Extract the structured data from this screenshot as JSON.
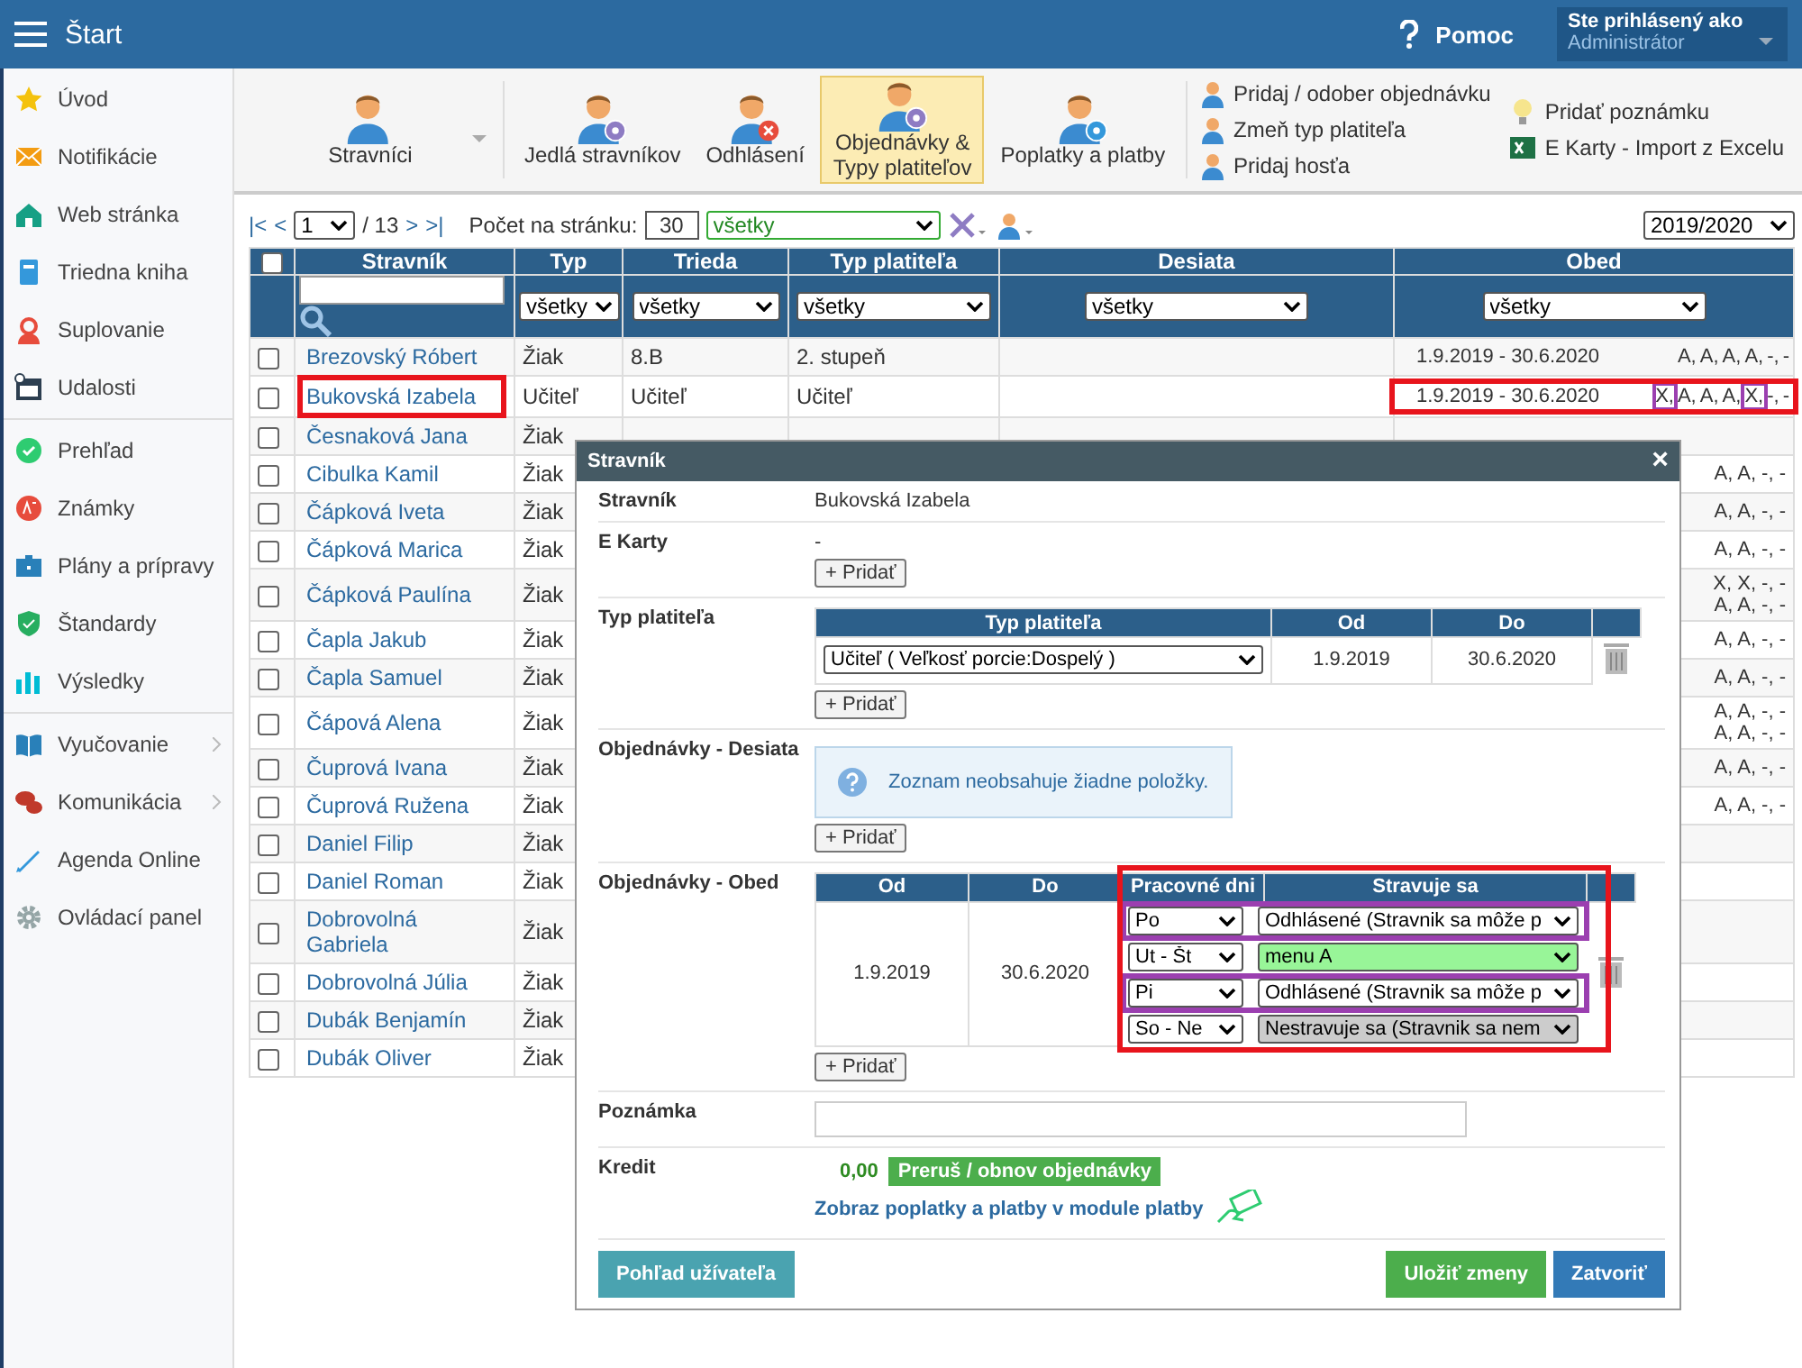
{
  "header": {
    "title": "Štart",
    "help": "Pomoc",
    "user_label": "Ste prihlásený ako",
    "user_name": "Administrátor"
  },
  "sidebar": {
    "groups": [
      [
        {
          "label": "Úvod",
          "chevron": false
        },
        {
          "label": "Notifikácie",
          "chevron": false
        },
        {
          "label": "Web stránka",
          "chevron": false
        },
        {
          "label": "Triedna kniha",
          "chevron": false
        },
        {
          "label": "Suplovanie",
          "chevron": false
        },
        {
          "label": "Udalosti",
          "chevron": false
        }
      ],
      [
        {
          "label": "Prehľad",
          "chevron": false
        },
        {
          "label": "Známky",
          "chevron": false
        },
        {
          "label": "Plány a prípravy",
          "chevron": false
        },
        {
          "label": "Štandardy",
          "chevron": false
        },
        {
          "label": "Výsledky",
          "chevron": false
        }
      ],
      [
        {
          "label": "Vyučovanie",
          "chevron": true
        },
        {
          "label": "Komunikácia",
          "chevron": true
        },
        {
          "label": "Agenda Online",
          "chevron": false
        },
        {
          "label": "Ovládací panel",
          "chevron": false
        }
      ]
    ]
  },
  "toolbar": {
    "buttons": [
      {
        "label": "Stravníci",
        "selected": false,
        "dropdown": true
      },
      {
        "label": "Jedlá stravníkov",
        "selected": false,
        "dropdown": false
      },
      {
        "label": "Odhlásení",
        "selected": false,
        "dropdown": false
      },
      {
        "label": "Objednávky & Typy platiteľov",
        "selected": true,
        "dropdown": false
      },
      {
        "label": "Poplatky a platby",
        "selected": false,
        "dropdown": false
      }
    ],
    "links": [
      [
        "Pridaj / odober objednávku",
        "Zmeň typ platiteľa",
        "Pridaj hosťa"
      ],
      [
        "Pridať poznámku",
        "E Karty - Import z Excelu"
      ]
    ]
  },
  "pager": {
    "first": "|<",
    "prev": "<",
    "page": "1",
    "total": "/ 13",
    "next": ">",
    "last": ">|",
    "per_page_label": "Počet na stránku:",
    "per_page": "30",
    "filter": "všetky",
    "year": "2019/2020"
  },
  "table": {
    "select_all": {
      "checked": false
    },
    "columns": [
      "Stravník",
      "Typ",
      "Trieda",
      "Typ platiteľa",
      "Desiata",
      "Obed"
    ],
    "filters": [
      "všetky",
      "všetky",
      "všetky",
      "všetky",
      "všetky"
    ],
    "rows": [
      {
        "checked": false,
        "name": "Brezovský Róbert",
        "typ": "Žiak",
        "trieda": "8.B",
        "platitel": "2. stupeň",
        "obed_date": "1.9.2019 - 30.6.2020",
        "codes": [
          {
            "code": "A,",
            "marked": false
          },
          {
            "code": "A,",
            "marked": false
          },
          {
            "code": "A,",
            "marked": false
          },
          {
            "code": "A,",
            "marked": false
          },
          {
            "code": "-,",
            "marked": false
          },
          {
            "code": "-",
            "marked": false
          }
        ],
        "highlight": false
      },
      {
        "checked": false,
        "name": "Bukovská Izabela",
        "typ": "Učiteľ",
        "trieda": "Učiteľ",
        "platitel": "Učiteľ",
        "obed_date": "1.9.2019 - 30.6.2020",
        "codes": [
          {
            "code": "X,",
            "marked": true
          },
          {
            "code": "A,",
            "marked": false
          },
          {
            "code": "A,",
            "marked": false
          },
          {
            "code": "A,",
            "marked": false
          },
          {
            "code": "X,",
            "marked": true
          },
          {
            "code": "-,",
            "marked": false
          },
          {
            "code": "-",
            "marked": false
          }
        ],
        "highlight": true
      }
    ],
    "covered_rows": [
      {
        "checked": false,
        "name": "Česnaková Jana",
        "typ": "Žiak",
        "obed_tail": []
      },
      {
        "checked": false,
        "name": "Cibulka Kamil",
        "typ": "Žiak",
        "obed_tail": [
          "A, A, -, -"
        ]
      },
      {
        "checked": false,
        "name": "Čápková Iveta",
        "typ": "Žiak",
        "obed_tail": [
          "A, A, -, -"
        ]
      },
      {
        "checked": false,
        "name": "Čápková Marica",
        "typ": "Žiak",
        "obed_tail": [
          "A, A, -, -"
        ]
      },
      {
        "checked": false,
        "name": "Čápková Paulína",
        "typ": "Žiak",
        "obed_tail": [
          "X, X, -, -",
          "A, A, -, -"
        ]
      },
      {
        "checked": false,
        "name": "Čapla Jakub",
        "typ": "Žiak",
        "obed_tail": [
          "A, A, -, -"
        ]
      },
      {
        "checked": false,
        "name": "Čapla Samuel",
        "typ": "Žiak",
        "obed_tail": [
          "A, A, -, -"
        ]
      },
      {
        "checked": false,
        "name": "Čápová Alena",
        "typ": "Žiak",
        "obed_tail": [
          "A, A, -, -",
          "A, A, -, -"
        ]
      },
      {
        "checked": false,
        "name": "Čuprová Ivana",
        "typ": "Žiak",
        "obed_tail": [
          "A, A, -, -"
        ]
      },
      {
        "checked": false,
        "name": "Čuprová Ružena",
        "typ": "Žiak",
        "obed_tail": [
          "A, A, -, -"
        ]
      },
      {
        "checked": false,
        "name": "Daniel Filip",
        "typ": "Žiak",
        "obed_tail": []
      },
      {
        "checked": false,
        "name": "Daniel Roman",
        "typ": "Žiak",
        "obed_tail": []
      },
      {
        "checked": false,
        "name": "Dobrovolná Gabriela",
        "typ": "Žiak",
        "obed_tail": []
      },
      {
        "checked": false,
        "name": "Dobrovolná Júlia",
        "typ": "Žiak",
        "obed_tail": []
      },
      {
        "checked": false,
        "name": "Dubák Benjamín",
        "typ": "Žiak",
        "obed_tail": []
      },
      {
        "checked": false,
        "name": "Dubák Oliver",
        "typ": "Žiak",
        "obed_tail": []
      }
    ]
  },
  "modal": {
    "title": "Stravník",
    "close": "×",
    "labels": {
      "name": "Stravník",
      "cards": "E Karty",
      "payer": "Typ platiteľa",
      "snack": "Objednávky - Desiata",
      "lunch": "Objednávky - Obed",
      "note": "Poznámka",
      "credit": "Kredit"
    },
    "name": "Bukovská Izabela",
    "cards": "-",
    "cards_add": "+ Pridať",
    "payer_table": {
      "columns": [
        "Typ platiteľa",
        "Od",
        "Do"
      ],
      "rows": [
        {
          "type": "Učiteľ ( Veľkosť porcie:Dospelý )",
          "from": "1.9.2019",
          "to": "30.6.2020"
        }
      ]
    },
    "payer_add": "+ Pridať",
    "snack_empty": "Zoznam neobsahuje žiadne položky.",
    "snack_add": "+ Pridať",
    "lunch_table": {
      "columns": [
        "Od",
        "Do",
        "Pracovné dni",
        "Stravuje sa"
      ],
      "from": "1.9.2019",
      "to": "30.6.2020",
      "highlight": true,
      "days": [
        {
          "days": "Po",
          "meal": "Odhlásené (Stravnik sa môže p",
          "kind": "off",
          "highlight": true
        },
        {
          "days": "Ut - Št",
          "meal": "menu A",
          "kind": "menu",
          "highlight": false
        },
        {
          "days": "Pi",
          "meal": "Odhlásené (Stravnik sa môže p",
          "kind": "off",
          "highlight": true
        },
        {
          "days": "So - Ne",
          "meal": "Nestravuje sa (Stravnik sa nem",
          "kind": "none",
          "highlight": false
        }
      ]
    },
    "lunch_add": "+ Pridať",
    "credit": "0,00",
    "pause_button": "Preruš / obnov objednávky",
    "payments_link": "Zobraz poplatky a platby v module platby",
    "user_view": "Pohľad užívateľa",
    "save": "Uložiť zmeny",
    "close_button": "Zatvoriť"
  }
}
